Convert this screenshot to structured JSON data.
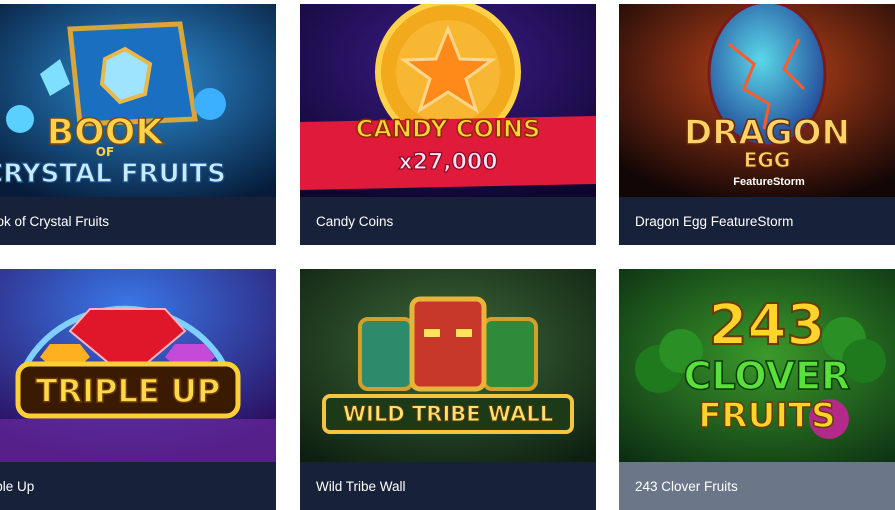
{
  "games": [
    {
      "id": "book-of-crystal-fruits",
      "title": "Book of Crystal Fruits",
      "art": {
        "line1": "BOOK",
        "line2": "OF",
        "line3": "CRYSTAL FRUITS"
      },
      "colors": {
        "bg": "#0b3a66",
        "accent": "#ffcc33",
        "text": "#bfe8ff"
      }
    },
    {
      "id": "candy-coins",
      "title": "Candy Coins",
      "art": {
        "line1": "CANDY COINS",
        "line2": "x27,000"
      },
      "colors": {
        "bg": "#1a0b4a",
        "accent": "#f7a21b",
        "ribbon": "#e01a3a"
      }
    },
    {
      "id": "dragon-egg",
      "title": "Dragon Egg FeatureStorm",
      "art": {
        "line1": "DRAGON",
        "line2": "EGG",
        "line3": "FeatureStorm"
      },
      "colors": {
        "bg": "#1b0b0b",
        "accent": "#ffd36a",
        "egg": "#2f6fbf"
      }
    },
    {
      "id": "triple-up",
      "title": "Triple Up",
      "art": {
        "line1": "TRIPLE UP"
      },
      "colors": {
        "bg": "#2a1270",
        "accent": "#ffcf3a",
        "gem": "#e0162b"
      }
    },
    {
      "id": "wild-tribe-wall",
      "title": "Wild Tribe Wall",
      "art": {
        "line1": "WILD TRIBE WALL"
      },
      "colors": {
        "bg": "#1f3a22",
        "accent": "#f5c542",
        "mask": "#d0452a"
      }
    },
    {
      "id": "243-clover-fruits",
      "title": "243 Clover Fruits",
      "art": {
        "line1": "243",
        "line2": "CLOVER",
        "line3": "FRUITS"
      },
      "colors": {
        "bg": "#1e4f1d",
        "accent": "#ffcc22",
        "clover": "#3fbf3a"
      }
    }
  ]
}
